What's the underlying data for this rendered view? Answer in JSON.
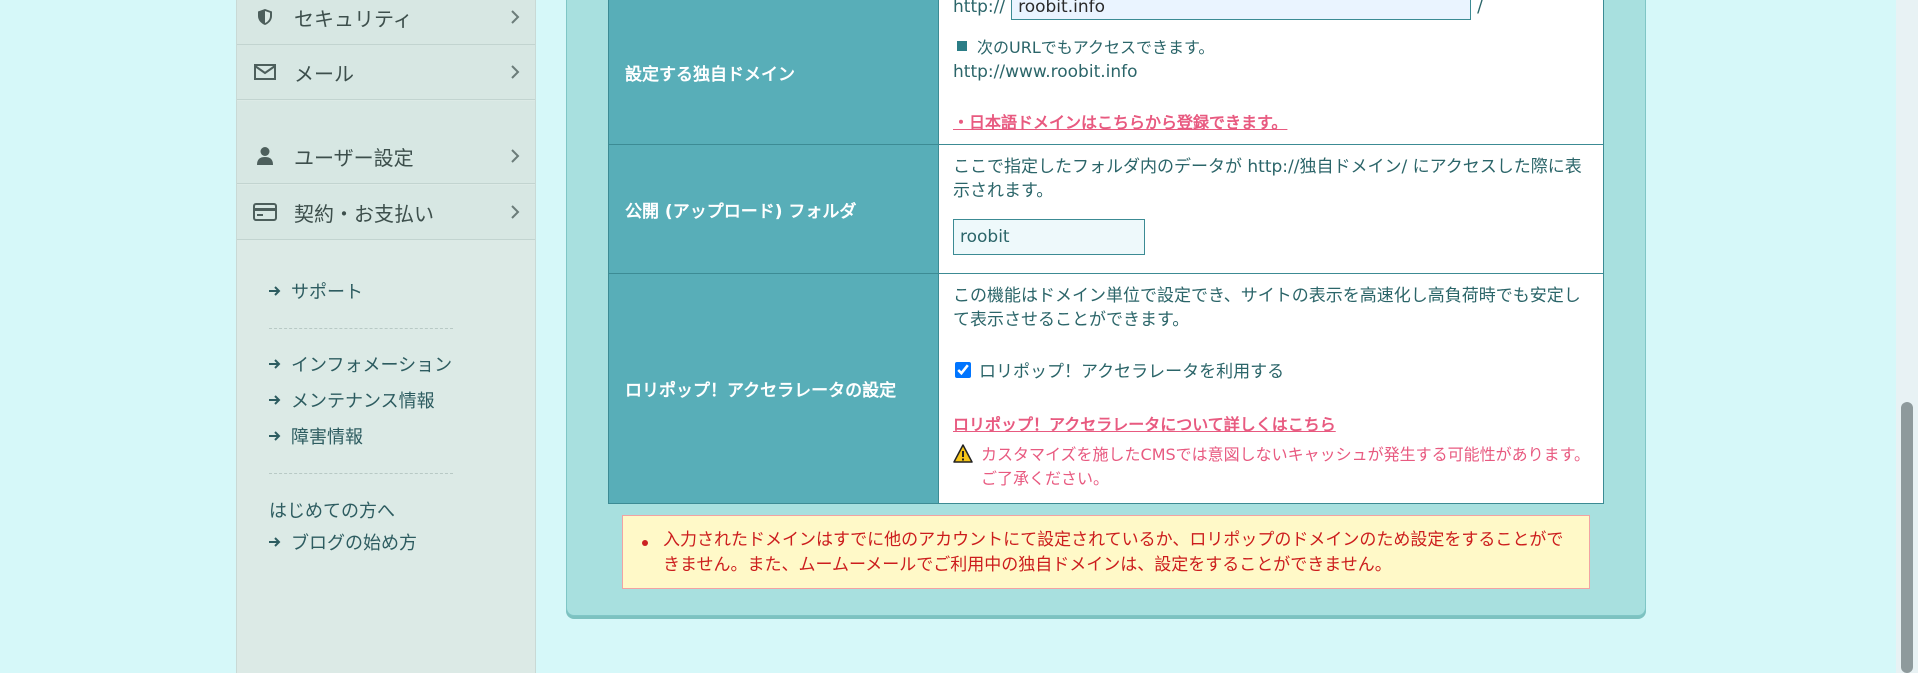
{
  "sidebar": {
    "menu": [
      {
        "label": "セキュリティ",
        "icon": "shield-icon"
      },
      {
        "label": "メール",
        "icon": "mail-icon"
      },
      {
        "label": "ユーザー設定",
        "icon": "user-icon"
      },
      {
        "label": "契約・お支払い",
        "icon": "credit-card-icon"
      }
    ],
    "links_group1": [
      "サポート"
    ],
    "links_group2": [
      "インフォメーション",
      "メンテナンス情報",
      "障害情報"
    ],
    "plain_link": "はじめての方へ",
    "links_group3": [
      "ブログの始め方"
    ]
  },
  "form": {
    "domain_row": {
      "label": "設定する独自ドメイン",
      "prefix": "http://",
      "domain_value": "roobit.info",
      "suffix": "/",
      "alt_url_note": "次のURLでもアクセスできます。",
      "alt_url": "http://www.roobit.info",
      "japanese_domain_link": "・日本語ドメインはこちらから登録できます。"
    },
    "folder_row": {
      "label": "公開 (アップロード) フォルダ",
      "description": "ここで指定したフォルダ内のデータが http://独自ドメイン/ にアクセスした際に表示されます。",
      "folder_value": "roobit"
    },
    "accelerator_row": {
      "label": "ロリポップ！アクセラレータの設定",
      "description": "この機能はドメイン単位で設定でき、サイトの表示を高速化し高負荷時でも安定して表示させることができます。",
      "checkbox_label": "ロリポップ！アクセラレータを利用する",
      "checkbox_checked": true,
      "detail_link": "ロリポップ！アクセラレータについて詳しくはこちら",
      "warning": "カスタマイズを施したCMSでは意図しないキャッシュが発生する可能性があります。ご了承ください。"
    }
  },
  "error": {
    "message": "入力されたドメインはすでに他のアカウントにて設定されているか、ロリポップのドメインのため設定をすることができません。また、ムームーメールでご利用中の独自ドメインは、設定をすることができません。"
  },
  "colors": {
    "background": "#d6f8f9",
    "header_cell": "#58aeb8",
    "link_pink": "#e85a80",
    "error_red": "#cc1d1d"
  }
}
